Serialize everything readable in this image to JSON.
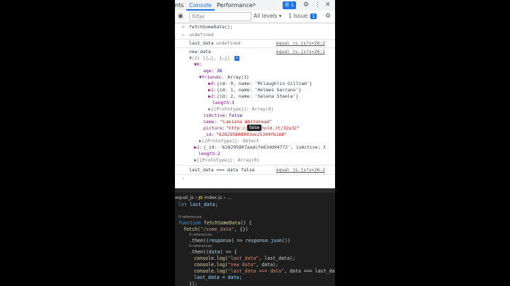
{
  "tabs": [
    "nts",
    "Console",
    "Performance"
  ],
  "active_tab": "Console",
  "tab_overflow": "»",
  "issues_badge": "1",
  "filter": {
    "placeholder": "Filter",
    "levels": "All levels ▾",
    "issues": "1 Issue:",
    "issues_count": "1"
  },
  "console": {
    "input1": "fetchSomeData();",
    "out1": "undefined",
    "log1_label": "last_data",
    "log1_value": "undefined",
    "source": "equal_js.js?v=26:2",
    "log2_label": "new data",
    "arr_summary": "▼(2) [{…}, {…}]",
    "info_glyph": "i",
    "idx0": "▼0:",
    "age_key": "age:",
    "age_val": "36",
    "friends_key": "▼friends:",
    "friends_val": "Array(3)",
    "f0_key": "▶0:",
    "f0_val": "{id: 0, name: 'Mclaughlin Gilliam'}",
    "f1_key": "▶1:",
    "f1_val": "{id: 1, name: 'Holmes Serrano'}",
    "f2_key": "▶2:",
    "f2_val": "{id: 2, name: 'Selena Steele'}",
    "flen_key": "length:",
    "flen_val": "3",
    "fproto": "▶[[Prototype]]: Array(0)",
    "active_key": "isActive:",
    "active_val": "false",
    "name_key": "name:",
    "name_val": "\"Lakisha Whitehead\"",
    "pic_key": "picture:",
    "pic_val": "\"http://placehold.it/32x32\"",
    "id_key": "_id:",
    "id_val": "\"628295808993de25304fb168\"",
    "oproto": "▶[[Prototype]]: Object",
    "idx1_key": "▶1:",
    "idx1_val": "{_id: '628295807aadcfe63dd94772', isActive: t",
    "len_key": "length:",
    "len_val": "2",
    "aproto": "▶[[Prototype]]: Array(0)",
    "log3": "last_data === data false",
    "prompt": "›",
    "tooltip": "false"
  },
  "editor": {
    "crumb_file": "equal_js",
    "crumb_lang": "JS",
    "crumb_rest": "index.js › ...",
    "l1_kw": "let",
    "l1_rest": "last_data;",
    "ref0": "0 references",
    "l2_kw": "function",
    "l2_fn": "fetchSomeData",
    "l2_rest": "() {",
    "l3_fn": "fetch",
    "l3_str": "\"/some_data\"",
    "l3_rest": ", {})",
    "ref1": "0 references",
    "l4_a": ".then((",
    "l4_v": "response",
    "l4_b": ") => ",
    "l4_c": "response.json",
    "l4_d": "())",
    "ref2": "0 references",
    "l5_a": ".then((",
    "l5_v": "data",
    "l5_b": ") => {",
    "l6_fn": "console.log",
    "l6_str": "\"last_data\"",
    "l6_rest": ", last_data);",
    "l7_fn": "console.log",
    "l7_str": "\"new data\"",
    "l7_rest": ", data);",
    "l8_fn": "console.log",
    "l8_str": "\"last_data === data\"",
    "l8_rest": ", data === last_data);",
    "l9": "last_data = data;",
    "l10": "});"
  }
}
